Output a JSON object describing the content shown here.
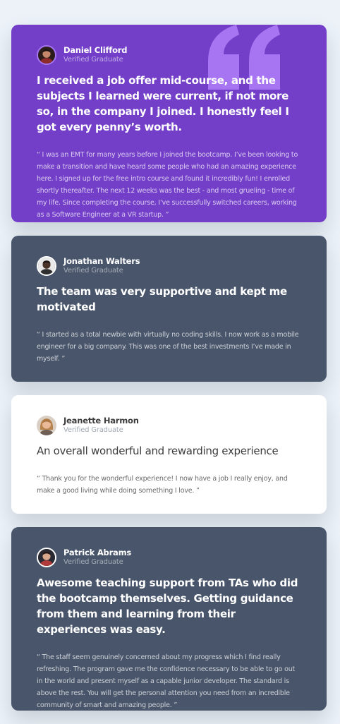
{
  "colors": {
    "page_bg": "#ECF2F8",
    "moderate_violet": "#733FC8",
    "grayish_blue": "#48556A",
    "white": "#FFFFFF",
    "light_violet": "#A775F1"
  },
  "testimonials": [
    {
      "name": "Daniel Clifford",
      "status": "Verified Graduate",
      "headline": "I received a job offer mid-course, and the subjects I learned were current, if not more so, in the company I joined. I honestly feel I got every penny’s worth.",
      "body": "“ I was an EMT for many years before I joined the bootcamp. I’ve been looking to make a transition and have heard some people who had an amazing experience here. I signed up for the free intro course and found it incredibly fun! I enrolled shortly thereafter. The next 12 weeks was the best - and most grueling - time of my life. Since completing the course, I’ve successfully switched careers, working as a Software Engineer at a VR startup. ”",
      "avatar_icon": "person-avatar-icon",
      "decoration_icon": "quotation-mark-icon"
    },
    {
      "name": "Jonathan Walters",
      "status": "Verified Graduate",
      "headline": "The team was very supportive and kept me motivated",
      "body": "“ I started as a total newbie with virtually no coding skills. I now work as a mobile engineer for a big company. This was one of the best investments I’ve made in myself. ”",
      "avatar_icon": "person-avatar-icon"
    },
    {
      "name": "Jeanette Harmon",
      "status": "Verified Graduate",
      "headline": "An overall wonderful and rewarding experience",
      "body": "“ Thank you for the wonderful experience! I now have a job I really enjoy, and make a good living while doing something I love. ”",
      "avatar_icon": "person-avatar-icon"
    },
    {
      "name": "Patrick Abrams",
      "status": "Verified Graduate",
      "headline": "Awesome teaching support from TAs who did the bootcamp themselves. Getting guidance from them and learning from their experiences was easy.",
      "body": "“ The staff seem genuinely concerned about my progress which I find really refreshing. The program gave me the confidence necessary to be able to go out in the world and present myself as a capable junior developer. The standard is above the rest. You will get the personal attention you need from an incredible community of smart and amazing people. ”",
      "avatar_icon": "person-avatar-icon"
    }
  ]
}
